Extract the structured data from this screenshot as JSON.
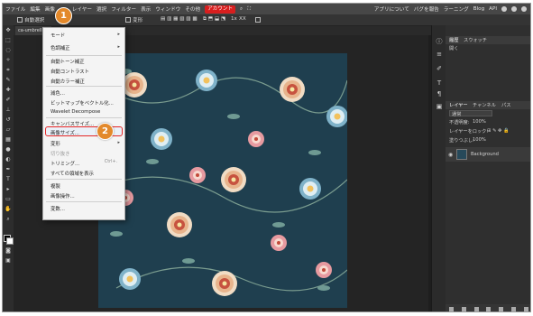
{
  "menubar": {
    "items": [
      "ファイル",
      "編集",
      "画像",
      "レイヤー",
      "選択",
      "フィルター",
      "表示",
      "ウィンドウ",
      "その他"
    ],
    "account": "アカウント",
    "right_items": [
      "アプリについて",
      "バグを報告",
      "ラーニング",
      "Blog",
      "API"
    ]
  },
  "optionsbar": {
    "auto_select": "自動選択",
    "transform": "変形",
    "zoom": "1x",
    "extra": "XX"
  },
  "document_tab": "ca-umbrella-...",
  "image_menu": {
    "items": [
      {
        "label": "モード",
        "arrow": "▸"
      },
      {
        "label": "色調補正",
        "arrow": "▸"
      },
      {
        "label": "自動トーン補正"
      },
      {
        "label": "自動コントラスト"
      },
      {
        "label": "自動カラー補正"
      },
      {
        "label": "減色..."
      },
      {
        "label": "ビットマップをベクトル化..."
      },
      {
        "label": "Wavelet Decompose"
      },
      {
        "label": "キャンバスサイズ..."
      },
      {
        "label": "画像サイズ..."
      },
      {
        "label": "変形",
        "arrow": "▸"
      },
      {
        "label": "切り抜き"
      },
      {
        "label": "トリミング...",
        "shortcut": "Ctrl+."
      },
      {
        "label": "すべての領域を表示"
      },
      {
        "label": "複製"
      },
      {
        "label": "画像操作..."
      },
      {
        "label": "変数..."
      }
    ]
  },
  "badges": {
    "step1": "1",
    "step2": "2"
  },
  "history_panel": {
    "tabs": [
      "履歴",
      "スウォッチ"
    ],
    "entry": "開く"
  },
  "layers_panel": {
    "tabs": [
      "レイヤー",
      "チャンネル",
      "パス"
    ],
    "blend_mode": "通常",
    "opacity_label": "不透明度:",
    "opacity_value": "100%",
    "lock_label": "レイヤーをロック:",
    "fill_label": "塗りつぶし:",
    "fill_value": "100%",
    "layer_name": "Background"
  },
  "colors": {
    "accent_red": "#d81e1e",
    "badge_orange": "#e3892b",
    "artwork_bg": "#1f3f4f"
  }
}
